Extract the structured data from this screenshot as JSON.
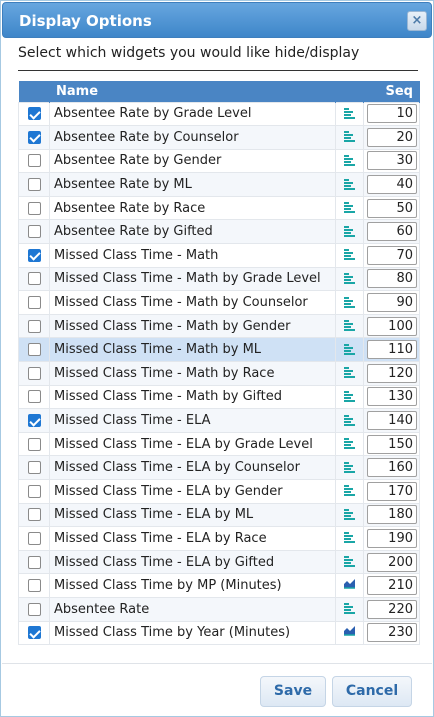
{
  "dialog": {
    "title": "Display Options",
    "close_label": "×",
    "subtitle": "Select which widgets you would like hide/display"
  },
  "table": {
    "headers": {
      "name": "Name",
      "seq": "Seq"
    },
    "rows": [
      {
        "checked": true,
        "name": "Absentee Rate by Grade Level",
        "icon": "bar-chart-icon",
        "seq": "10"
      },
      {
        "checked": true,
        "name": "Absentee Rate by Counselor",
        "icon": "bar-chart-icon",
        "seq": "20"
      },
      {
        "checked": false,
        "name": "Absentee Rate by Gender",
        "icon": "bar-chart-icon",
        "seq": "30"
      },
      {
        "checked": false,
        "name": "Absentee Rate by ML",
        "icon": "bar-chart-icon",
        "seq": "40"
      },
      {
        "checked": false,
        "name": "Absentee Rate by Race",
        "icon": "bar-chart-icon",
        "seq": "50"
      },
      {
        "checked": false,
        "name": "Absentee Rate by Gifted",
        "icon": "bar-chart-icon",
        "seq": "60"
      },
      {
        "checked": true,
        "name": "Missed Class Time - Math",
        "icon": "bar-chart-icon",
        "seq": "70"
      },
      {
        "checked": false,
        "name": "Missed Class Time - Math by Grade Level",
        "icon": "bar-chart-icon",
        "seq": "80"
      },
      {
        "checked": false,
        "name": "Missed Class Time - Math by Counselor",
        "icon": "bar-chart-icon",
        "seq": "90"
      },
      {
        "checked": false,
        "name": "Missed Class Time - Math by Gender",
        "icon": "bar-chart-icon",
        "seq": "100"
      },
      {
        "checked": false,
        "name": "Missed Class Time - Math by ML",
        "icon": "bar-chart-icon",
        "seq": "110",
        "highlighted": true
      },
      {
        "checked": false,
        "name": "Missed Class Time - Math by Race",
        "icon": "bar-chart-icon",
        "seq": "120"
      },
      {
        "checked": false,
        "name": "Missed Class Time - Math by Gifted",
        "icon": "bar-chart-icon",
        "seq": "130"
      },
      {
        "checked": true,
        "name": "Missed Class Time - ELA",
        "icon": "bar-chart-icon",
        "seq": "140"
      },
      {
        "checked": false,
        "name": "Missed Class Time - ELA by Grade Level",
        "icon": "bar-chart-icon",
        "seq": "150"
      },
      {
        "checked": false,
        "name": "Missed Class Time - ELA by Counselor",
        "icon": "bar-chart-icon",
        "seq": "160"
      },
      {
        "checked": false,
        "name": "Missed Class Time - ELA by Gender",
        "icon": "bar-chart-icon",
        "seq": "170"
      },
      {
        "checked": false,
        "name": "Missed Class Time - ELA by ML",
        "icon": "bar-chart-icon",
        "seq": "180"
      },
      {
        "checked": false,
        "name": "Missed Class Time - ELA by Race",
        "icon": "bar-chart-icon",
        "seq": "190"
      },
      {
        "checked": false,
        "name": "Missed Class Time - ELA by Gifted",
        "icon": "bar-chart-icon",
        "seq": "200"
      },
      {
        "checked": false,
        "name": "Missed Class Time by MP (Minutes)",
        "icon": "area-chart-icon",
        "seq": "210"
      },
      {
        "checked": false,
        "name": "Absentee Rate",
        "icon": "bar-chart-icon",
        "seq": "220"
      },
      {
        "checked": true,
        "name": "Missed Class Time by Year (Minutes)",
        "icon": "area-chart-icon",
        "seq": "230"
      }
    ]
  },
  "buttons": {
    "save": "Save",
    "cancel": "Cancel"
  },
  "colors": {
    "header_blue": "#4a85c4",
    "title_blue": "#3e86c9",
    "checkbox_blue": "#1e77d3",
    "icon_teal": "#1aa6a6",
    "area_icon_blue": "#2a5fb0",
    "highlight_row": "#cfe1f5"
  }
}
